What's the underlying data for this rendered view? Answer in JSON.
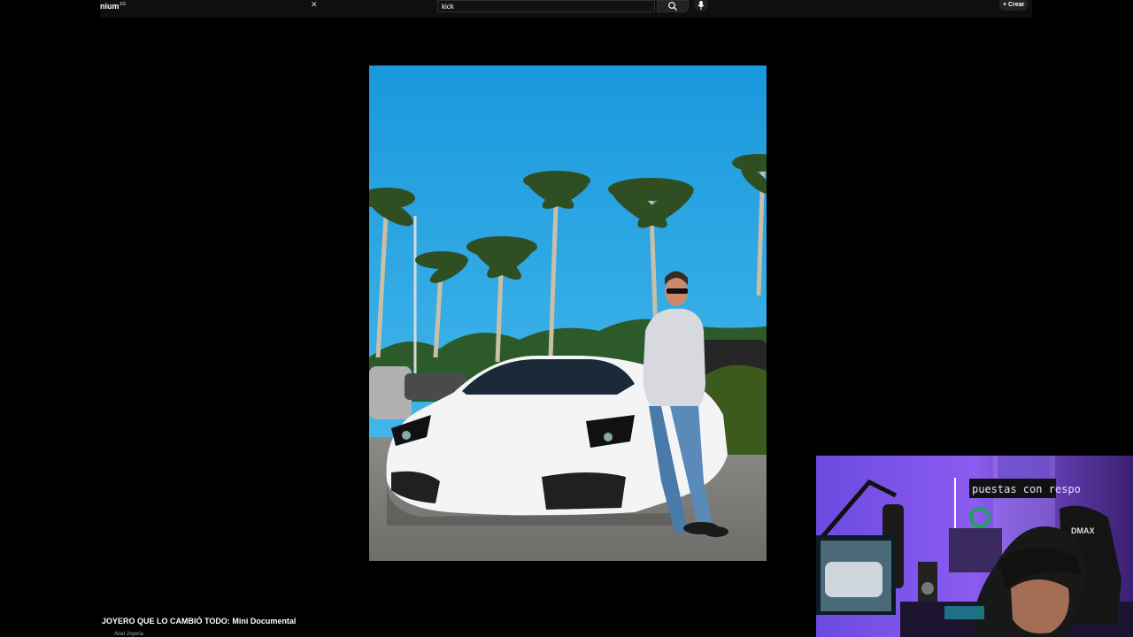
{
  "header": {
    "logo_text": "nium",
    "logo_sup": "ES",
    "search_value": "kick",
    "create_label": "Crear"
  },
  "video": {
    "title": "JOYERO QUE LO CAMBIÓ TODO: Mini Documental",
    "channel": "Ariel Joyeria"
  },
  "webcam": {
    "led_sign_text": "puestas con respo",
    "chair_brand": "DMAX"
  },
  "colors": {
    "sky": "#1da1e3",
    "accent": "#ff0000"
  }
}
